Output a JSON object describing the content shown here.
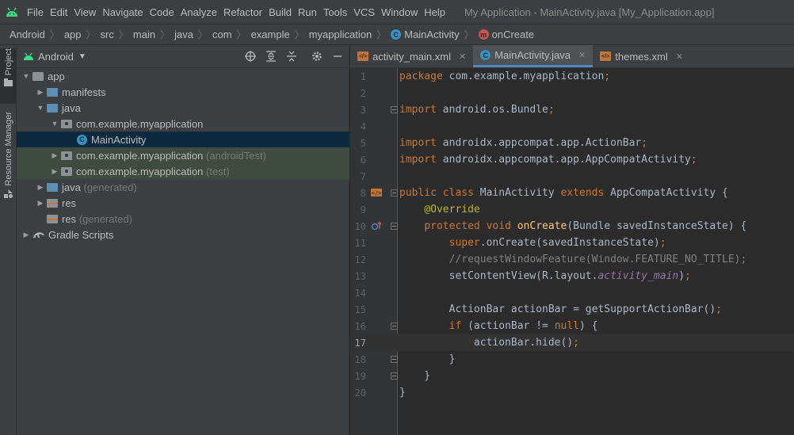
{
  "window": {
    "title": "My Application - MainActivity.java [My_Application.app]",
    "menu": [
      "File",
      "Edit",
      "View",
      "Navigate",
      "Code",
      "Analyze",
      "Refactor",
      "Build",
      "Run",
      "Tools",
      "VCS",
      "Window",
      "Help"
    ]
  },
  "breadcrumb": [
    "Android",
    "app",
    "src",
    "main",
    "java",
    "com",
    "example",
    "myapplication",
    "MainActivity",
    "onCreate"
  ],
  "toolstrip": {
    "project": "Project",
    "resource_manager": "Resource Manager"
  },
  "project": {
    "view_mode": "Android",
    "tree": {
      "app": "app",
      "manifests": "manifests",
      "java": "java",
      "pkg_main": "com.example.myapplication",
      "main_activity": "MainActivity",
      "pkg_android_test": "com.example.myapplication",
      "android_test_suffix": "(androidTest)",
      "pkg_test": "com.example.myapplication",
      "test_suffix": "(test)",
      "java_generated": "java",
      "java_generated_suffix": "(generated)",
      "res": "res",
      "res_generated": "res",
      "res_generated_suffix": "(generated)",
      "gradle_scripts": "Gradle Scripts"
    }
  },
  "tabs": [
    {
      "label": "activity_main.xml",
      "icon": "xml-file-icon",
      "active": false
    },
    {
      "label": "MainActivity.java",
      "icon": "java-class-icon",
      "active": true
    },
    {
      "label": "themes.xml",
      "icon": "xml-file-icon",
      "active": false
    }
  ],
  "editor": {
    "current_line": 17,
    "line_numbers": [
      "1",
      "2",
      "3",
      "4",
      "5",
      "6",
      "7",
      "8",
      "9",
      "10",
      "11",
      "12",
      "13",
      "14",
      "15",
      "16",
      "17",
      "18",
      "19",
      "20"
    ],
    "lines": [
      "package com.example.myapplication;",
      "",
      "import android.os.Bundle;",
      "",
      "import androidx.appcompat.app.ActionBar;",
      "import androidx.appcompat.app.AppCompatActivity;",
      "",
      "public class MainActivity extends AppCompatActivity {",
      "    @Override",
      "    protected void onCreate(Bundle savedInstanceState) {",
      "        super.onCreate(savedInstanceState);",
      "        //requestWindowFeature(Window.FEATURE_NO_TITLE);",
      "        setContentView(R.layout.activity_main);",
      "",
      "        ActionBar actionBar = getSupportActionBar();",
      "        if (actionBar != null) {",
      "            actionBar.hide();",
      "        }",
      "    }",
      "}"
    ]
  },
  "colors": {
    "keyword": "#cc7832",
    "annotation": "#bbb529",
    "method": "#ffc66d",
    "comment": "#808080",
    "field": "#9876aa",
    "accent": "#4a88c7"
  }
}
